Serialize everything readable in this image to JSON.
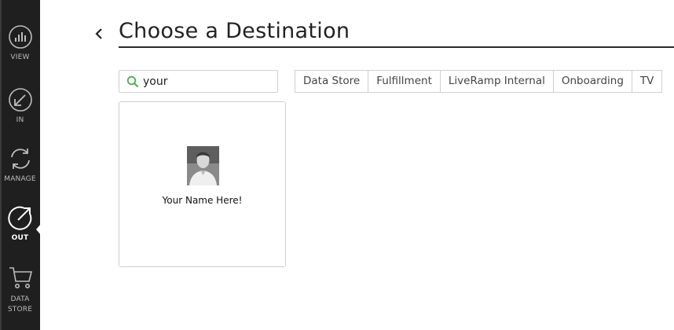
{
  "sidebar": {
    "items": [
      {
        "label": "VIEW",
        "icon": "chart-circle-icon"
      },
      {
        "label": "IN",
        "icon": "arrow-in-circle-icon"
      },
      {
        "label": "MANAGE",
        "icon": "refresh-circle-icon"
      },
      {
        "label": "OUT",
        "icon": "arrow-out-circle-icon",
        "active": true
      },
      {
        "label_line1": "DATA",
        "label_line2": "STORE",
        "icon": "cart-icon"
      }
    ]
  },
  "header": {
    "title": "Choose a Destination",
    "back_icon": "chevron-left-icon"
  },
  "search": {
    "value": "your",
    "placeholder": "",
    "icon": "search-icon"
  },
  "filters": [
    "Data Store",
    "Fulfillment",
    "LiveRamp Internal",
    "Onboarding",
    "TV"
  ],
  "results": [
    {
      "name": "Your Name Here!",
      "thumbnail": "person-photo"
    }
  ],
  "colors": {
    "sidebar": "#1f1f1f",
    "search_icon": "#4caf50",
    "border": "#cfcfcf"
  }
}
